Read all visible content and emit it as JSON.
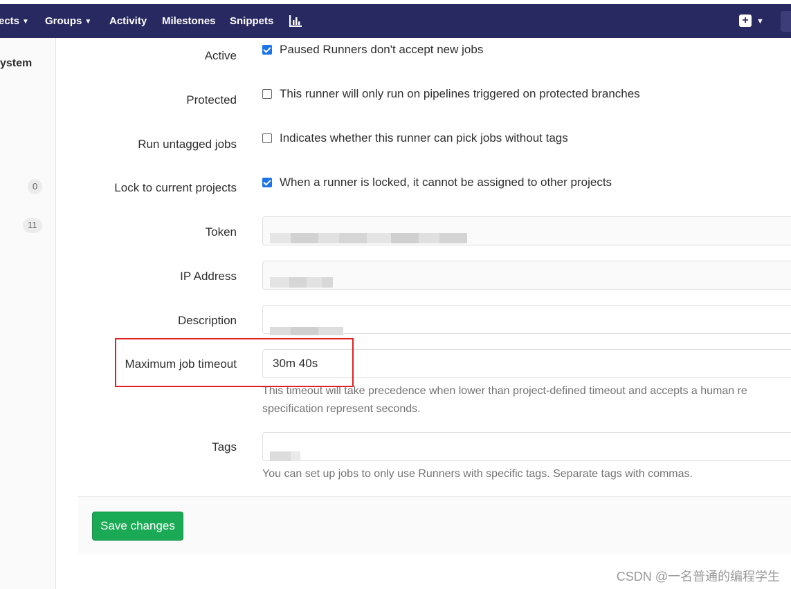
{
  "nav": {
    "items": [
      {
        "label": "ects",
        "chevron": true
      },
      {
        "label": "Groups",
        "chevron": true
      },
      {
        "label": "Activity",
        "chevron": false
      },
      {
        "label": "Milestones",
        "chevron": false
      },
      {
        "label": "Snippets",
        "chevron": false
      }
    ],
    "chart_icon": "chart-icon",
    "new_icon": "plus-square-icon",
    "bg_color": "#292961"
  },
  "sidebar": {
    "label": "ystem",
    "badges": [
      "0",
      "11"
    ]
  },
  "form": {
    "active": {
      "label": "Active",
      "text": "Paused Runners don't accept new jobs",
      "checked": true
    },
    "protected": {
      "label": "Protected",
      "text": "This runner will only run on pipelines triggered on protected branches",
      "checked": false
    },
    "untagged": {
      "label": "Run untagged jobs",
      "text": "Indicates whether this runner can pick jobs without tags",
      "checked": false
    },
    "locked": {
      "label": "Lock to current projects",
      "text": "When a runner is locked, it cannot be assigned to other projects",
      "checked": true
    },
    "token": {
      "label": "Token"
    },
    "ip": {
      "label": "IP Address"
    },
    "description": {
      "label": "Description"
    },
    "timeout": {
      "label": "Maximum job timeout",
      "value": "30m 40s",
      "help_line1": "This timeout will take precedence when lower than project-defined timeout and accepts a human re",
      "help_line2": "specification represent seconds."
    },
    "tags": {
      "label": "Tags",
      "help": "You can set up jobs to only use Runners with specific tags. Separate tags with commas."
    }
  },
  "actions": {
    "save_label": "Save changes",
    "save_color": "#1aaa55"
  },
  "watermark": "CSDN @一名普通的编程学生"
}
